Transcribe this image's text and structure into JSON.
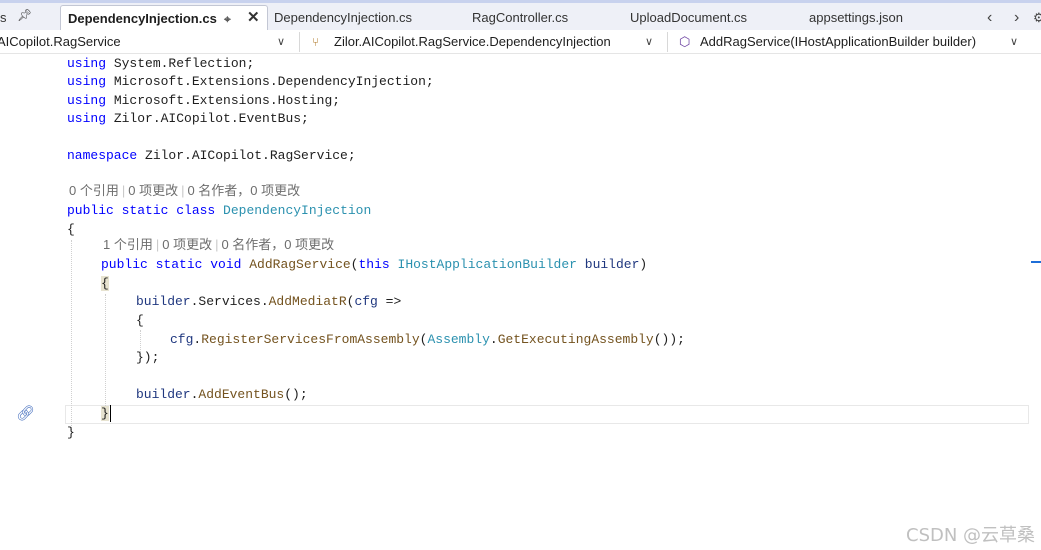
{
  "tabs": {
    "partial_left": "s",
    "active": "DependencyInjection.cs",
    "others": [
      "DependencyInjection.cs",
      "RagController.cs",
      "UploadDocument.cs",
      "appsettings.json"
    ]
  },
  "icons": {
    "pin": "pin-icon",
    "close": "close-icon",
    "scroll_left": "chevron-left-icon",
    "scroll_right": "chevron-right-icon",
    "dropdown": "chevron-down-icon",
    "namespace": "namespace-icon",
    "method": "method-icon",
    "gutter": "link-icon"
  },
  "navbar": {
    "project": "AICopilot.RagService",
    "type": "Zilor.AICopilot.RagService.DependencyInjection",
    "member": "AddRagService(IHostApplicationBuilder builder)"
  },
  "code": {
    "l1": {
      "kw": "using",
      "rest": " System.Reflection;"
    },
    "l2": {
      "kw": "using",
      "rest": " Microsoft.Extensions.DependencyInjection;"
    },
    "l3": {
      "kw": "using",
      "rest": " Microsoft.Extensions.Hosting;"
    },
    "l4": {
      "kw": "using",
      "rest": " Zilor.AICopilot.EventBus;"
    },
    "ns": {
      "kw": "namespace",
      "rest": " Zilor.AICopilot.RagService;"
    },
    "lens1": {
      "refs": "0 个引用",
      "changes": "0 项更改",
      "authors": "0 名作者，0 项更改"
    },
    "cls": {
      "kw": "public static class",
      "name": "DependencyInjection"
    },
    "open_brace": "{",
    "lens2": {
      "refs": "1 个引用",
      "changes": "0 项更改",
      "authors": "0 名作者，0 项更改"
    },
    "method": {
      "kw": "public static void",
      "name": "AddRagService",
      "open": "(",
      "this_kw": "this",
      "param_type": "IHostApplicationBuilder",
      "param_name": "builder",
      "close": ")"
    },
    "m_open": "{",
    "l_mediatr": {
      "a": "builder",
      "b": ".Services.",
      "c": "AddMediatR",
      "d": "(",
      "e": "cfg",
      "f": " =>"
    },
    "l_lam_open": "{",
    "l_register": {
      "a": "cfg",
      "b": ".",
      "c": "RegisterServicesFromAssembly",
      "d": "(",
      "e": "Assembly",
      "f": ".",
      "g": "GetExecutingAssembly",
      "h": "());"
    },
    "l_lam_close": "});",
    "l_eventbus": {
      "a": "builder",
      "b": ".",
      "c": "AddEventBus",
      "d": "();"
    },
    "m_close": "}",
    "class_close": "}"
  },
  "watermark": "CSDN @云草桑"
}
